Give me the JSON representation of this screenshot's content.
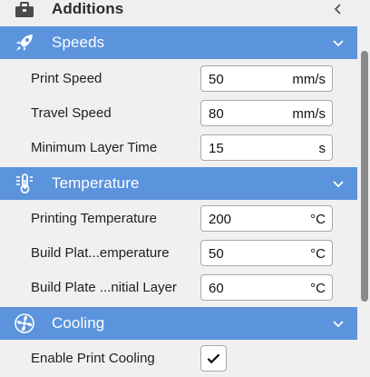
{
  "sections": {
    "additions": {
      "title": "Additions",
      "icon": "toolbox-icon",
      "chevron": "chevron-left-icon"
    },
    "speeds": {
      "title": "Speeds",
      "icon": "rocket-icon",
      "chevron": "chevron-down-icon"
    },
    "temperature": {
      "title": "Temperature",
      "icon": "thermometer-icon",
      "chevron": "chevron-down-icon"
    },
    "cooling": {
      "title": "Cooling",
      "icon": "fan-icon",
      "chevron": "chevron-down-icon"
    }
  },
  "speeds": {
    "print_speed": {
      "label": "Print Speed",
      "value": "50",
      "unit": "mm/s"
    },
    "travel_speed": {
      "label": "Travel Speed",
      "value": "80",
      "unit": "mm/s"
    },
    "min_layer_time": {
      "label": "Minimum Layer Time",
      "value": "15",
      "unit": "s"
    }
  },
  "temperature": {
    "printing_temp": {
      "label": "Printing Temperature",
      "value": "200",
      "unit": "°C"
    },
    "build_plate_temp": {
      "label": "Build Plat...emperature",
      "value": "50",
      "unit": "°C"
    },
    "build_plate_initial": {
      "label": "Build Plate ...nitial Layer",
      "value": "60",
      "unit": "°C"
    }
  },
  "cooling": {
    "enable_print_cooling": {
      "label": "Enable Print Cooling",
      "checked": true
    }
  },
  "colors": {
    "header_blue": "#5b93dc",
    "panel_bg": "#f0f0f0",
    "field_border": "#a9a9a9"
  }
}
